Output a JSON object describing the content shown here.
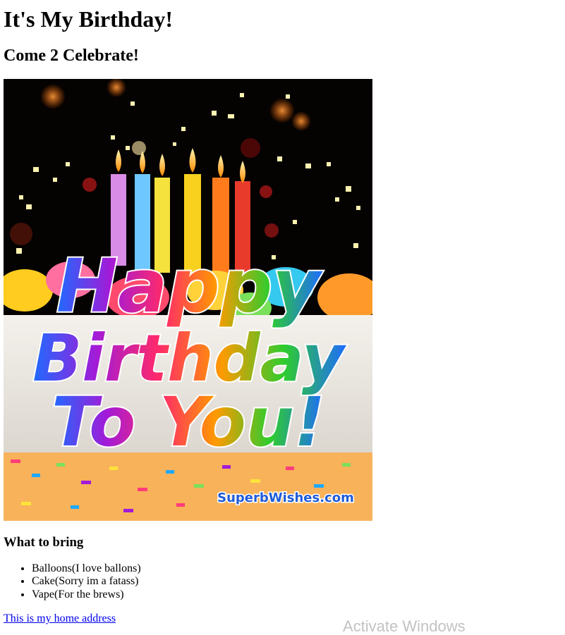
{
  "page": {
    "title": "It's My Birthday!",
    "subtitle": "Come 2 Celebrate!"
  },
  "image": {
    "lines": [
      "Happy",
      "Birthday",
      "To You!"
    ],
    "watermark": "SuperbWishes.com"
  },
  "bring": {
    "heading": "What to bring",
    "items": [
      "Balloons(I love ballons)",
      "Cake(Sorry im a fatass)",
      "Vape(For the brews)"
    ]
  },
  "link": {
    "label": "This is my home address"
  },
  "overlay": {
    "text": "Activate Windows"
  },
  "colors": {
    "link": "#0000ee",
    "text": "#000000",
    "background": "#ffffff"
  }
}
